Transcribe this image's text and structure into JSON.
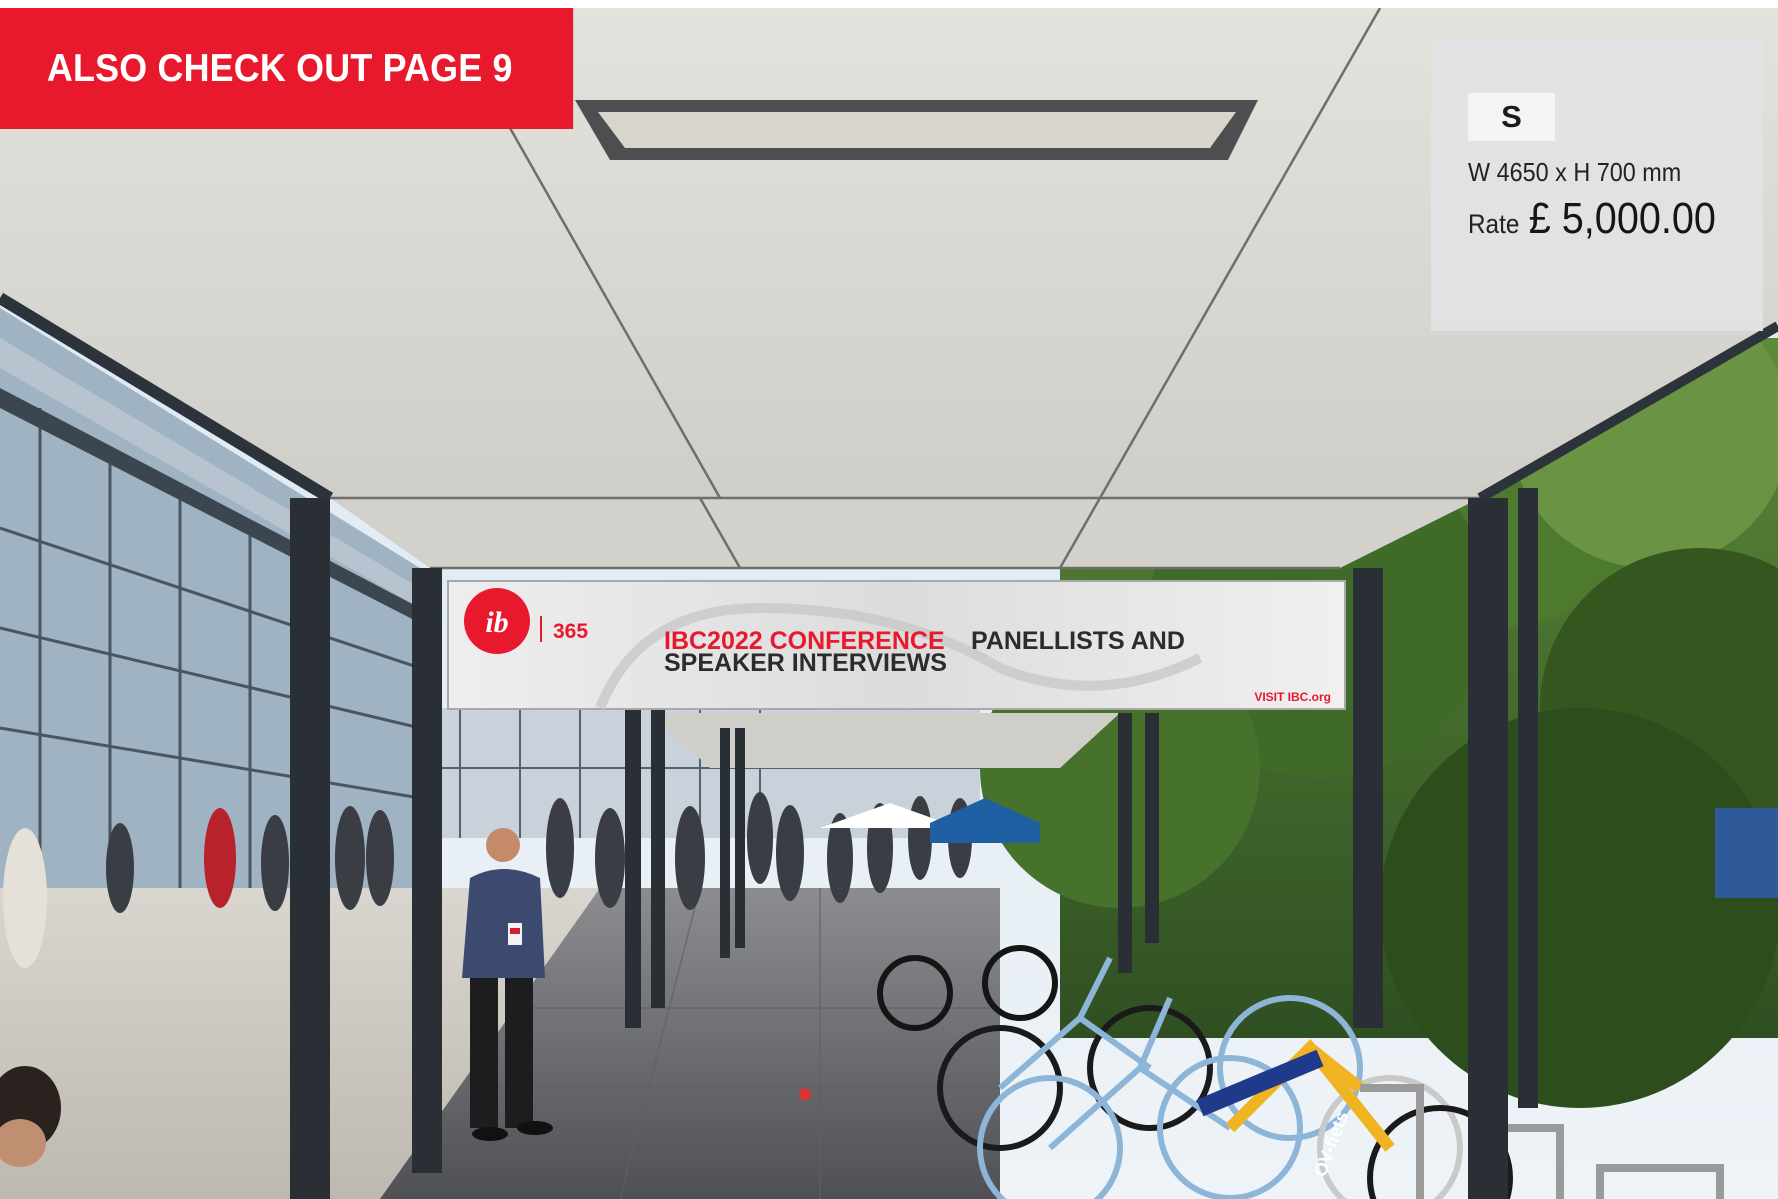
{
  "promo_banner": {
    "text": "ALSO CHECK OUT PAGE 9"
  },
  "spec_box": {
    "size_code": "S",
    "dimensions": "W 4650 x H 700 mm",
    "rate_label": "Rate",
    "rate_value": "£ 5,000.00"
  },
  "photo_signage": {
    "logo_text": "ib",
    "brand_suffix": "365",
    "headline_red": "IBC2022 CONFERENCE",
    "headline_dark_1": "PANELLISTS AND",
    "headline_dark_2": "SPEAKER INTERVIEWS",
    "footer_link": "VISIT IBC.org",
    "bike_label": "OV-fiets"
  },
  "colors": {
    "brand_red": "#e8192c",
    "box_gray": "#e1e3e4",
    "canopy_white": "#dcdbd6",
    "pillar_dark": "#2a2f36",
    "foliage_green": "#3e6a2a"
  }
}
